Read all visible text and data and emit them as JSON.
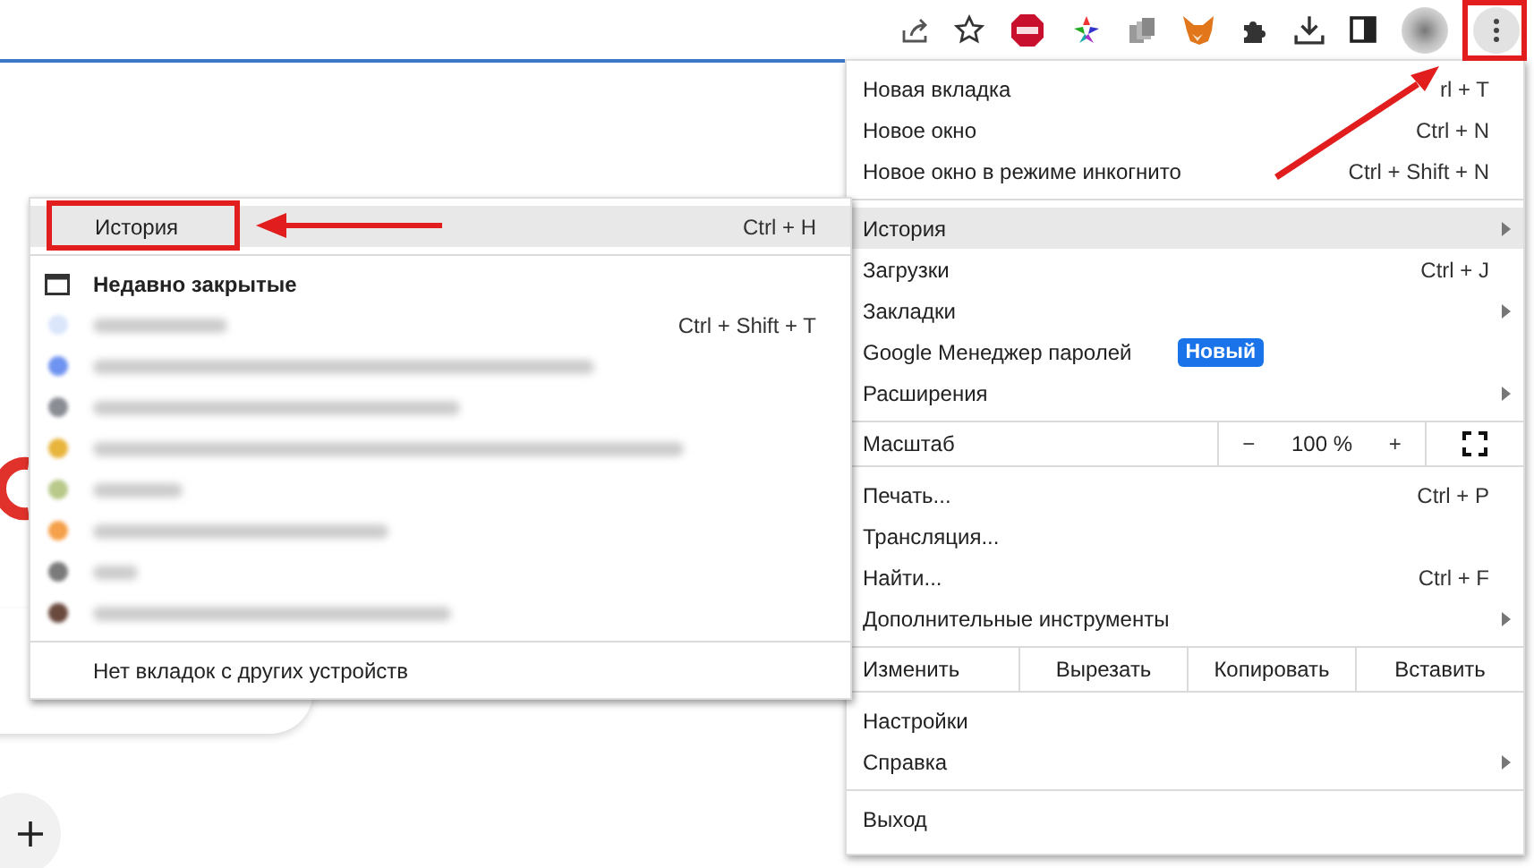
{
  "main_menu": {
    "sections": [
      {
        "items": [
          {
            "kind": "item",
            "label": "Новая вкладка",
            "shortcut": "rl + T",
            "submenu": false,
            "selected": false
          },
          {
            "kind": "item",
            "label": "Новое окно",
            "shortcut": "Ctrl + N",
            "submenu": false,
            "selected": false
          },
          {
            "kind": "item",
            "label": "Новое окно в режиме инкогнито",
            "shortcut": "Ctrl + Shift + N",
            "submenu": false,
            "selected": false
          }
        ]
      },
      {
        "items": [
          {
            "kind": "item",
            "label": "История",
            "submenu": true,
            "selected": true
          },
          {
            "kind": "item",
            "label": "Загрузки",
            "shortcut": "Ctrl + J",
            "submenu": false,
            "selected": false
          },
          {
            "kind": "item",
            "label": "Закладки",
            "submenu": true,
            "selected": false
          },
          {
            "kind": "item",
            "label": "Google Менеджер паролей",
            "badge": "Новый",
            "submenu": false,
            "selected": false
          },
          {
            "kind": "item",
            "label": "Расширения",
            "submenu": true,
            "selected": false
          }
        ]
      },
      {
        "items": [
          {
            "kind": "zoom",
            "label": "Масштаб",
            "minus": "−",
            "value": "100 %",
            "plus": "+"
          }
        ]
      },
      {
        "items": [
          {
            "kind": "item",
            "label": "Печать...",
            "shortcut": "Ctrl + P",
            "submenu": false,
            "selected": false
          },
          {
            "kind": "item",
            "label": "Трансляция...",
            "submenu": false,
            "selected": false
          },
          {
            "kind": "item",
            "label": "Найти...",
            "shortcut": "Ctrl + F",
            "submenu": false,
            "selected": false
          },
          {
            "kind": "item",
            "label": "Дополнительные инструменты",
            "submenu": true,
            "selected": false
          }
        ]
      },
      {
        "items": [
          {
            "kind": "edit",
            "label": "Изменить",
            "actions": [
              "Вырезать",
              "Копировать",
              "Вставить"
            ]
          }
        ]
      },
      {
        "items": [
          {
            "kind": "item",
            "label": "Настройки",
            "submenu": false,
            "selected": false
          },
          {
            "kind": "item",
            "label": "Справка",
            "submenu": true,
            "selected": false
          }
        ]
      },
      {
        "items": [
          {
            "kind": "item",
            "label": "Выход",
            "submenu": false,
            "selected": false
          }
        ]
      }
    ]
  },
  "history_menu": {
    "top_item": {
      "label": "История",
      "shortcut": "Ctrl + H",
      "selected": true
    },
    "recently_closed": "Недавно закрытые",
    "entries": [
      {
        "color": "#dbe6fb",
        "shortcut": "Ctrl + Shift + T"
      },
      {
        "color": "#6f93f0"
      },
      {
        "color": "#8a8d94"
      },
      {
        "color": "#e8b53c"
      },
      {
        "color": "#b8c98a"
      },
      {
        "color": "#f5a04a"
      },
      {
        "color": "#7a7a7a"
      },
      {
        "color": "#6b4a3e"
      }
    ],
    "footer": "Нет вкладок с других устройств"
  }
}
